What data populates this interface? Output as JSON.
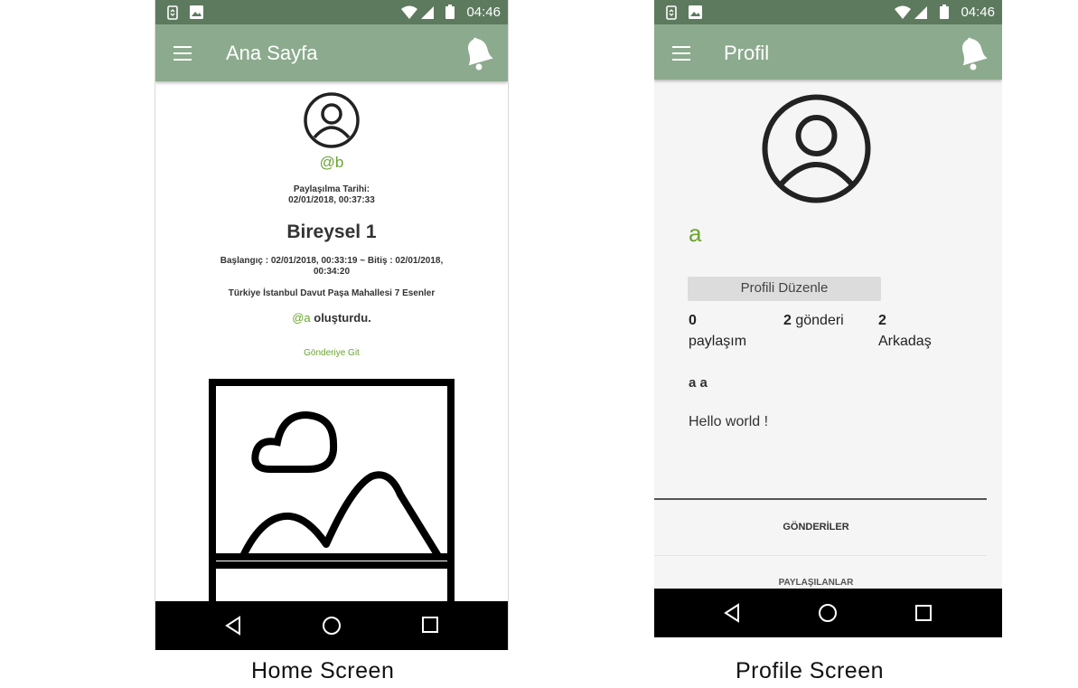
{
  "status_bar": {
    "time": "04:46"
  },
  "home": {
    "title": "Ana Sayfa",
    "username": "@b",
    "share_date_label": "Paylaşılma Tarihi:",
    "share_date_value": "02/01/2018, 00:37:33",
    "post_title": "Bireysel 1",
    "dates_line1": "Başlangıç : 02/01/2018, 00:33:19 ~ Bitiş : 02/01/2018,",
    "dates_line2": "00:34:20",
    "location": "Türkiye İstanbul Davut Paşa Mahallesi 7 Esenler",
    "creator_handle": "@a",
    "creator_suffix": "oluşturdu.",
    "go_to_post": "Gönderiye Git",
    "image_icon": "image-placeholder-icon"
  },
  "profile": {
    "title": "Profil",
    "name": "a",
    "edit_button": "Profili Düzenle",
    "stats": [
      {
        "value": "0",
        "label": "paylaşım"
      },
      {
        "value": "2",
        "label": "gönderi"
      },
      {
        "value": "2",
        "label": "Arkadaş"
      }
    ],
    "full_name": "a a",
    "bio": "Hello world !",
    "tabs": [
      "GÖNDERİLER",
      "PAYLAŞILANLAR"
    ]
  },
  "captions": {
    "home": "Home Screen",
    "profile": "Profile Screen"
  },
  "colors": {
    "accent_green": "#6aa52f",
    "appbar": "#8caa8d",
    "statusbar": "#5d7a5e"
  }
}
